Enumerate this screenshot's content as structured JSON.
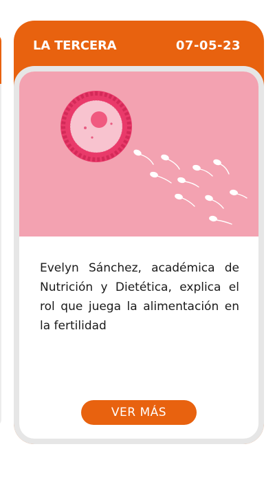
{
  "card": {
    "source": "LA TERCERA",
    "date": "07-05-23",
    "image_icon": "egg-and-sperm-illustration",
    "description": "Evelyn Sánchez, académica de Nutrición y Dietética, explica el rol que juega la alimentación en la fertilidad",
    "button_label": "VER MÁS"
  },
  "colors": {
    "accent": "#e8620f",
    "image_bg": "#f3a2b1",
    "egg_outer": "#e93a6a",
    "egg_inner": "#f8c3cf"
  }
}
